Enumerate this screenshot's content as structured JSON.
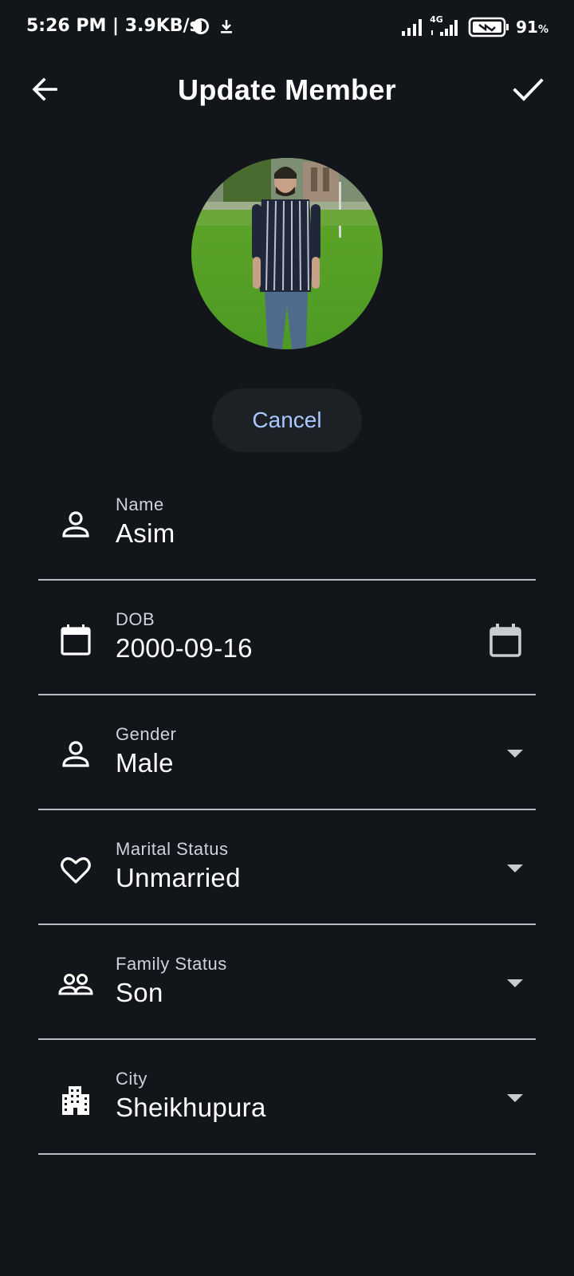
{
  "status_bar": {
    "time_speed": "5:26 PM | 3.9KB/s",
    "network_label": "4G",
    "battery_value": "91",
    "battery_unit": "%"
  },
  "app_bar": {
    "title": "Update Member",
    "back_icon": "arrow-back-icon",
    "confirm_icon": "check-icon"
  },
  "profile": {
    "photo": "member-photo",
    "cancel_label": "Cancel"
  },
  "form": {
    "fields": [
      {
        "label": "Name",
        "value": "Asim",
        "icon": "person-icon"
      },
      {
        "label": "DOB",
        "value": "2000-09-16",
        "icon": "calendar-icon",
        "trailing_icon": "calendar-picker-icon"
      },
      {
        "label": "Gender",
        "value": "Male",
        "icon": "person-icon",
        "trailing_icon": "dropdown-arrow-icon"
      },
      {
        "label": "Marital Status",
        "value": "Unmarried",
        "icon": "heart-icon",
        "trailing_icon": "dropdown-arrow-icon"
      },
      {
        "label": "Family Status",
        "value": "Son",
        "icon": "people-icon",
        "trailing_icon": "dropdown-arrow-icon"
      },
      {
        "label": "City",
        "value": "Sheikhupura",
        "icon": "building-icon",
        "trailing_icon": "dropdown-arrow-icon"
      }
    ]
  },
  "colors": {
    "background": "#12151a",
    "accent": "#a8c8ff",
    "button_bg": "#1d2126",
    "divider": "#b9bcc2"
  }
}
